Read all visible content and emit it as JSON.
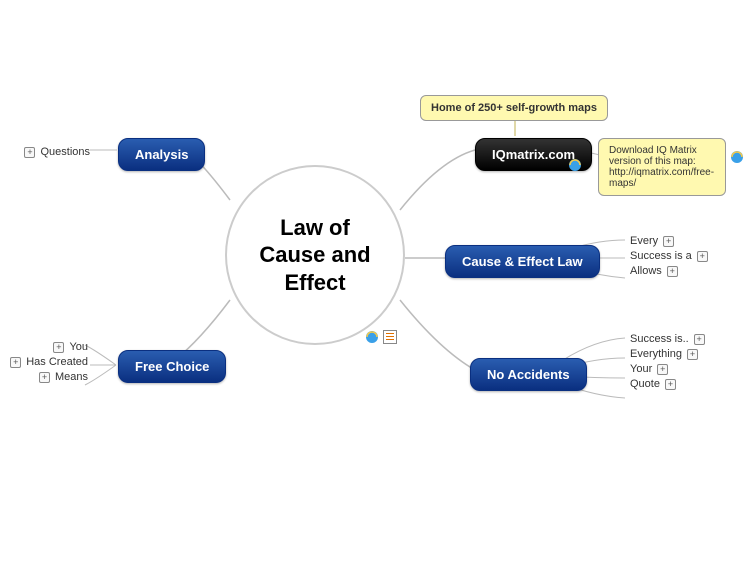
{
  "center": {
    "title": "Law of Cause and Effect"
  },
  "nodes": {
    "analysis": {
      "label": "Analysis",
      "children": [
        "Questions"
      ]
    },
    "freeChoice": {
      "label": "Free Choice",
      "children": [
        "You",
        "Has Created",
        "Means"
      ]
    },
    "iqmatrix": {
      "label": "IQmatrix.com",
      "callout": "Home of 250+ self-growth maps",
      "download": "Download IQ Matrix version of this map: http://iqmatrix.com/free-maps/"
    },
    "causeEffect": {
      "label": "Cause & Effect Law",
      "children": [
        "Every",
        "Success is a",
        "Allows"
      ]
    },
    "noAccidents": {
      "label": "No Accidents",
      "children": [
        "Success is..",
        "Everything",
        "Your",
        "Quote"
      ]
    }
  },
  "icons": {
    "expand": "+",
    "ie": "e",
    "note": "note"
  }
}
